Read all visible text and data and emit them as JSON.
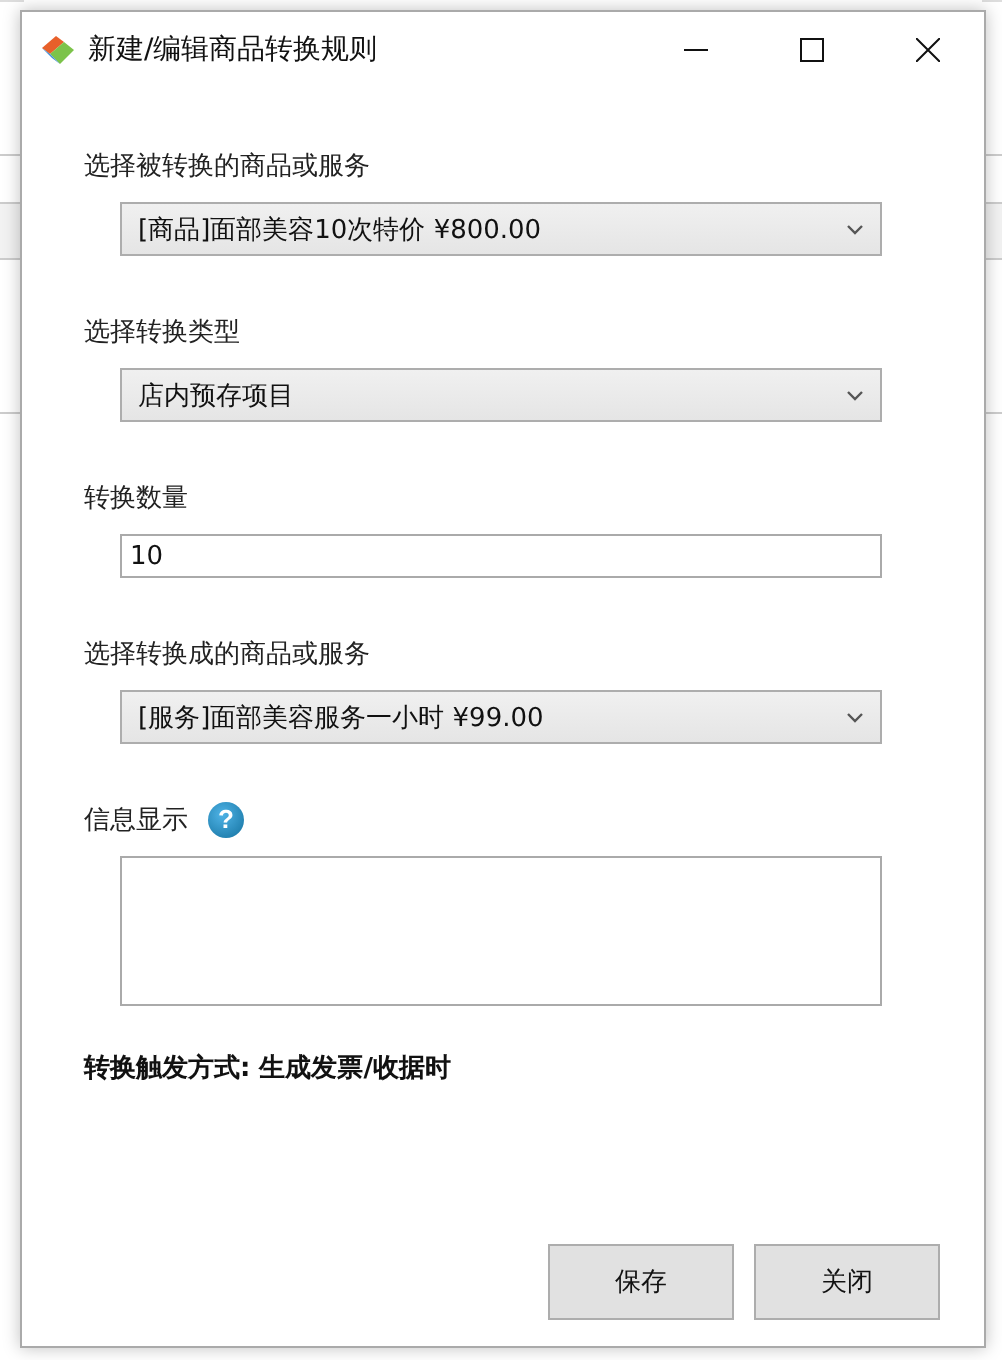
{
  "window": {
    "title": "新建/编辑商品转换规则"
  },
  "fields": [
    {
      "kind": "select",
      "label": "选择被转换的商品或服务",
      "value": "[商品]面部美容10次特价 ¥800.00"
    },
    {
      "kind": "select",
      "label": "选择转换类型",
      "value": "店内预存项目"
    },
    {
      "kind": "input",
      "label": "转换数量",
      "value": "10"
    },
    {
      "kind": "select",
      "label": "选择转换成的商品或服务",
      "value": "[服务]面部美容服务一小时 ¥99.00"
    },
    {
      "kind": "textarea",
      "label": "信息显示",
      "help": "?"
    }
  ],
  "trigger_note": "转换触发方式: 生成发票/收据时",
  "buttons": [
    "保存",
    "关闭"
  ]
}
